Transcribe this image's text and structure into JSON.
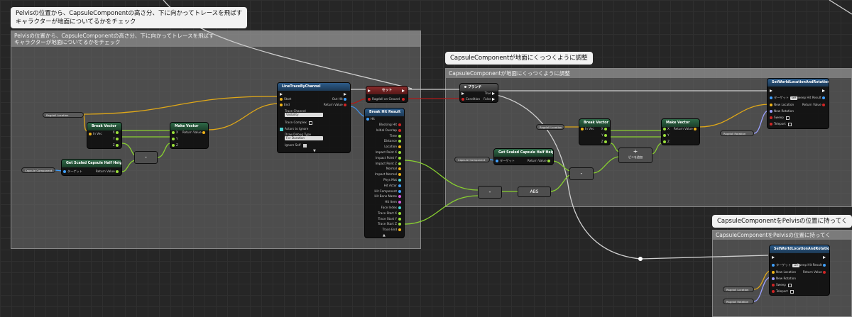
{
  "bubbles": {
    "top": "Pelvisの位置から、CapsuleComponentの高さ分、下に向かってトレースを飛ばす\nキャラクターが地面についてるかをチェック",
    "middle": "CapsuleComponentが地面にくっつくように調整",
    "right": "CapsuleComponentをPelvisの位置に持ってく"
  },
  "comments": {
    "trace": "Pelvisの位置から、CapsuleComponentの高さ分、下に向かってトレースを飛ばす\nキャラクターが地面についてるかをチェック",
    "adjust": "CapsuleComponentが地面にくっつくように調整",
    "move": "CapsuleComponentをPelvisの位置に持ってく"
  },
  "nodes": {
    "ragdoll_location_1": "Ragdoll Location",
    "capsule_component_1": "Capsule Component",
    "break_vector_1": {
      "title": "Break Vector",
      "in": "In Vec",
      "x": "X",
      "y": "Y",
      "z": "Z"
    },
    "make_vector_1": {
      "title": "Make Vector",
      "x": "X",
      "y": "Y",
      "z": "Z",
      "out": "Return Value"
    },
    "minus_1": "-",
    "get_half_height_1": {
      "title": "Get Scaled Capsule Half Height",
      "target": "ターゲット",
      "out": "Return Value"
    },
    "line_trace": {
      "title": "LineTraceByChannel",
      "start": "Start",
      "end": "End",
      "trace_channel": "Trace Channel",
      "channel_value": "Visibility",
      "trace_complex": "Trace Complex",
      "actors_to_ignore": "Actors to Ignore",
      "draw_debug_type": "Draw Debug Type",
      "debug_value": "For Duration",
      "ignore_self": "Ignore Self",
      "out_hit": "Out Hit",
      "return_value": "Return Value"
    },
    "set_node": {
      "title": "セット",
      "var": "Ragdoll on Ground"
    },
    "break_hit": {
      "title": "Break Hit Result",
      "hit": "Hit",
      "pins": [
        "Blocking Hit",
        "Initial Overlap",
        "Time",
        "Distance",
        "Location",
        "Impact Point X",
        "Impact Point Y",
        "Impact Point Z",
        "Normal",
        "Impact Normal",
        "Phys Mat",
        "Hit Actor",
        "Hit Component",
        "Hit Bone Name",
        "Hit Item",
        "Face Index",
        "Trace Start X",
        "Trace Start Y",
        "Trace Start Z",
        "Trace End"
      ]
    },
    "branch": {
      "title": "ブランチ",
      "condition": "Condition",
      "true": "True",
      "false": "False"
    },
    "ragdoll_location_2": "Ragdoll Location",
    "capsule_component_2": "Capsule Component",
    "get_half_height_2": {
      "title": "Get Scaled Capsule Half Height",
      "target": "ターゲット",
      "out": "Return Value"
    },
    "break_vector_2": {
      "title": "Break Vector",
      "in": "In Vec",
      "x": "X",
      "y": "Y",
      "z": "Z"
    },
    "make_vector_2": {
      "title": "Make Vector",
      "x": "X",
      "y": "Y",
      "z": "Z",
      "out": "Return Value"
    },
    "plus": {
      "symbol": "+",
      "label": "ピンを追加"
    },
    "minus_2": "-",
    "minus_3": "-",
    "abs": "ABS",
    "set_world_1": {
      "title": "SetWorldLocationAndRotation",
      "target": "ターゲット",
      "target_tag": "self",
      "new_location": "New Location",
      "new_rotation": "New Rotation",
      "sweep": "Sweep",
      "teleport": "Teleport",
      "sweep_hit": "Sweep Hit Result",
      "return_value": "Return Value"
    },
    "ragdoll_rotation_1": "Ragdoll Rotation",
    "set_world_2": {
      "title": "SetWorldLocationAndRotation",
      "target": "ターゲット",
      "target_tag": "self",
      "new_location": "New Location",
      "new_rotation": "New Rotation",
      "sweep": "Sweep",
      "teleport": "Teleport",
      "sweep_hit": "Sweep Hit Result",
      "return_value": "Return Value"
    },
    "ragdoll_location_3": "Ragdoll Location",
    "ragdoll_rotation_2": "Ragdoll Rotation"
  },
  "colors": {
    "exec": "#ffffff",
    "vector": "#f0b418",
    "float": "#9be03a",
    "object": "#3fa0ff",
    "bool": "#d02525",
    "rotator": "#a0a0ff"
  }
}
